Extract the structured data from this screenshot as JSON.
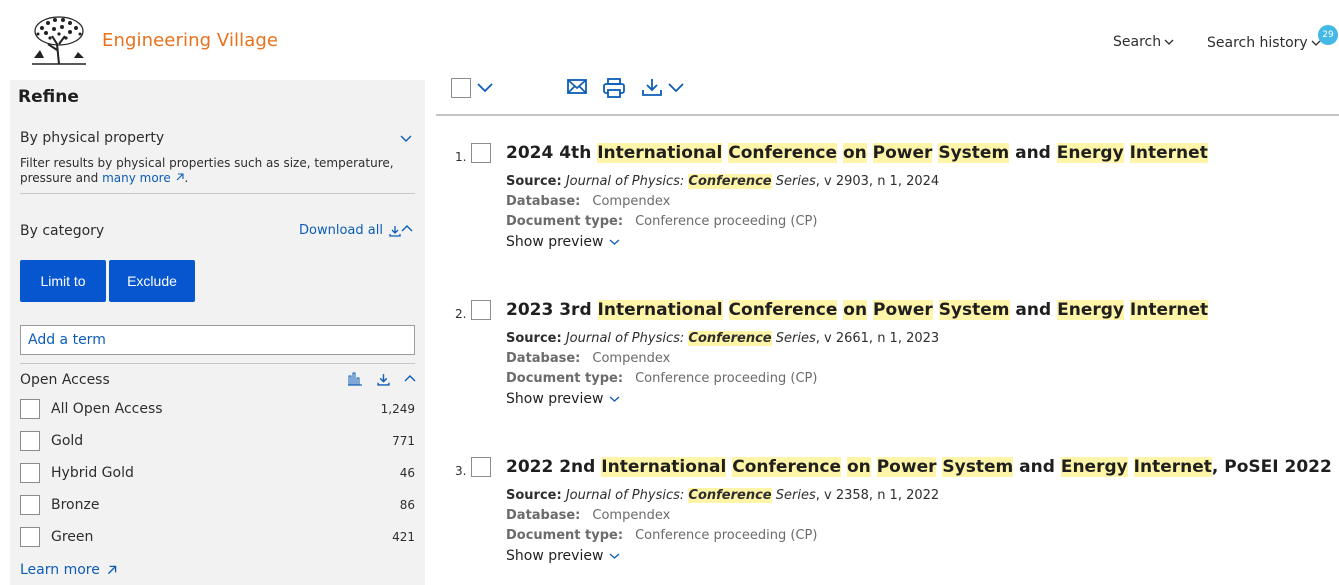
{
  "header": {
    "brand": "Engineering Village",
    "nav": {
      "search": "Search",
      "history": "Search history",
      "history_badge": "29"
    }
  },
  "sidebar": {
    "title": "Refine",
    "physical": {
      "title": "By physical property",
      "desc": "Filter results by physical properties such as size, temperature, pressure and",
      "desc_link": "many more"
    },
    "category": {
      "title": "By category",
      "download_all": "Download all",
      "limit_button": "Limit to",
      "exclude_button": "Exclude",
      "term_placeholder": "Add a term"
    },
    "open_access": {
      "title": "Open Access",
      "items": [
        {
          "label": "All Open Access",
          "count": "1,249"
        },
        {
          "label": "Gold",
          "count": "771"
        },
        {
          "label": "Hybrid Gold",
          "count": "46"
        },
        {
          "label": "Bronze",
          "count": "86"
        },
        {
          "label": "Green",
          "count": "421"
        }
      ],
      "learn_more": "Learn more"
    }
  },
  "results": [
    {
      "num": "1.",
      "title": [
        {
          "t": "2024 4th ",
          "hl": false
        },
        {
          "t": "International",
          "hl": true
        },
        {
          "t": " ",
          "hl": false
        },
        {
          "t": "Conference",
          "hl": true
        },
        {
          "t": " ",
          "hl": false
        },
        {
          "t": "on",
          "hl": true
        },
        {
          "t": " ",
          "hl": false
        },
        {
          "t": "Power",
          "hl": true
        },
        {
          "t": " ",
          "hl": false
        },
        {
          "t": "System",
          "hl": true
        },
        {
          "t": " and ",
          "hl": false
        },
        {
          "t": "Energy",
          "hl": true
        },
        {
          "t": " ",
          "hl": false
        },
        {
          "t": "Internet",
          "hl": true
        }
      ],
      "source_label": "Source:",
      "source_journal_prefix": "Journal of Physics: ",
      "source_journal_hl": "Conference",
      "source_journal_suffix": " Series",
      "source_rest": ", v 2903, n 1, 2024",
      "database_label": "Database:",
      "database": "Compendex",
      "doctype_label": "Document type:",
      "doctype": "Conference proceeding (CP)",
      "preview": "Show preview"
    },
    {
      "num": "2.",
      "title": [
        {
          "t": "2023 3rd ",
          "hl": false
        },
        {
          "t": "International",
          "hl": true
        },
        {
          "t": " ",
          "hl": false
        },
        {
          "t": "Conference",
          "hl": true
        },
        {
          "t": " ",
          "hl": false
        },
        {
          "t": "on",
          "hl": true
        },
        {
          "t": " ",
          "hl": false
        },
        {
          "t": "Power",
          "hl": true
        },
        {
          "t": " ",
          "hl": false
        },
        {
          "t": "System",
          "hl": true
        },
        {
          "t": " and ",
          "hl": false
        },
        {
          "t": "Energy",
          "hl": true
        },
        {
          "t": " ",
          "hl": false
        },
        {
          "t": "Internet",
          "hl": true
        }
      ],
      "source_label": "Source:",
      "source_journal_prefix": "Journal of Physics: ",
      "source_journal_hl": "Conference",
      "source_journal_suffix": " Series",
      "source_rest": ", v 2661, n 1, 2023",
      "database_label": "Database:",
      "database": "Compendex",
      "doctype_label": "Document type:",
      "doctype": "Conference proceeding (CP)",
      "preview": "Show preview"
    },
    {
      "num": "3.",
      "title": [
        {
          "t": "2022 2nd ",
          "hl": false
        },
        {
          "t": "International",
          "hl": true
        },
        {
          "t": " ",
          "hl": false
        },
        {
          "t": "Conference",
          "hl": true
        },
        {
          "t": " ",
          "hl": false
        },
        {
          "t": "on",
          "hl": true
        },
        {
          "t": " ",
          "hl": false
        },
        {
          "t": "Power",
          "hl": true
        },
        {
          "t": " ",
          "hl": false
        },
        {
          "t": "System",
          "hl": true
        },
        {
          "t": " and ",
          "hl": false
        },
        {
          "t": "Energy",
          "hl": true
        },
        {
          "t": " ",
          "hl": false
        },
        {
          "t": "Internet",
          "hl": true
        },
        {
          "t": ", PoSEI 2022",
          "hl": false
        }
      ],
      "source_label": "Source:",
      "source_journal_prefix": "Journal of Physics: ",
      "source_journal_hl": "Conference",
      "source_journal_suffix": " Series",
      "source_rest": ", v 2358, n 1, 2022",
      "database_label": "Database:",
      "database": "Compendex",
      "doctype_label": "Document type:",
      "doctype": "Conference proceeding (CP)",
      "preview": "Show preview"
    }
  ],
  "colors": {
    "brand": "#e9711c",
    "accent": "#0656d0",
    "link": "#0c5db8",
    "highlight": "#fff5a8",
    "badge": "#44b9e6"
  },
  "icons": [
    "elsevier-tree-logo",
    "chevron-down-icon",
    "chevron-up-icon",
    "download-icon",
    "bar-chart-icon",
    "external-link-icon",
    "email-icon",
    "print-icon"
  ]
}
